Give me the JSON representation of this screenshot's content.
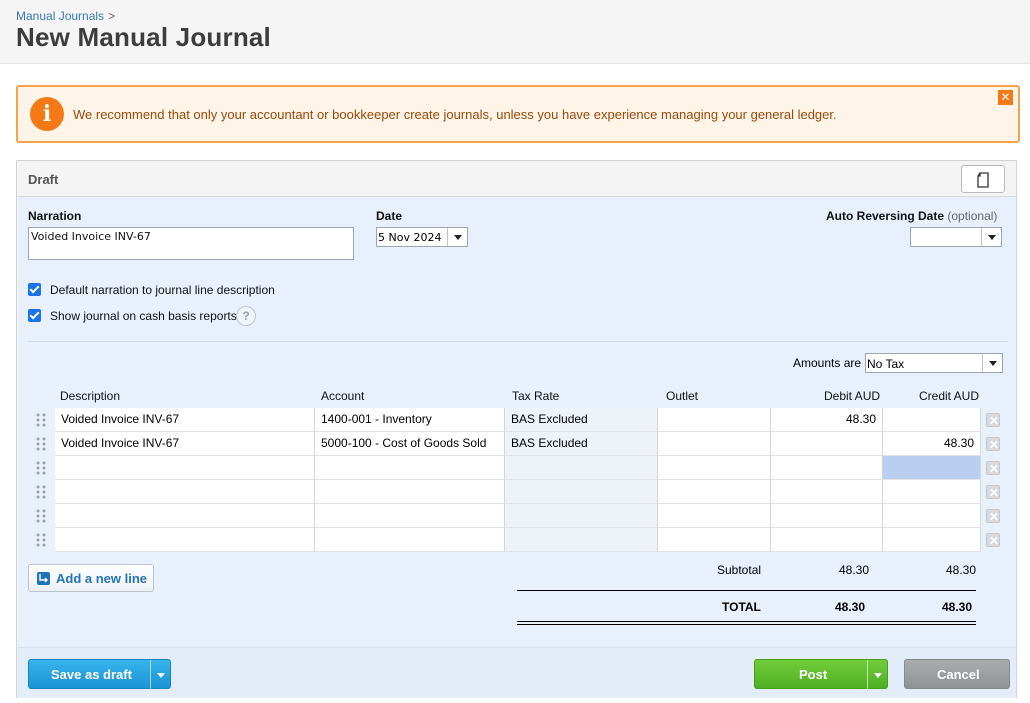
{
  "breadcrumb": {
    "parent": "Manual Journals",
    "separator": ">"
  },
  "page": {
    "title": "New Manual Journal"
  },
  "warning": {
    "message": "We recommend that only your accountant or bookkeeper create journals, unless you have experience managing your general ledger.",
    "icon": "info-icon",
    "close": "✕"
  },
  "panel": {
    "status": "Draft"
  },
  "form": {
    "narration_label": "Narration",
    "narration_value": "Voided Invoice INV-67",
    "date_label": "Date",
    "date_value": "5 Nov 2024",
    "auto_reversing_label": "Auto Reversing Date",
    "auto_reversing_optional": "(optional)",
    "auto_reversing_value": "",
    "default_narration_label": "Default narration to journal line description",
    "default_narration_checked": true,
    "cash_basis_label": "Show journal on cash basis reports",
    "cash_basis_checked": true,
    "help": "?",
    "amounts_are_label": "Amounts are",
    "amounts_are_value": "No Tax"
  },
  "table": {
    "headers": [
      "Description",
      "Account",
      "Tax Rate",
      "Outlet",
      "Debit AUD",
      "Credit AUD"
    ],
    "rows": [
      [
        "Voided Invoice INV-67",
        "1400-001 - Inventory",
        "BAS Excluded",
        "",
        "48.30",
        ""
      ],
      [
        "Voided Invoice INV-67",
        "5000-100 - Cost of Goods Sold",
        "BAS Excluded",
        "",
        "",
        "48.30"
      ],
      [
        "",
        "",
        "",
        "",
        "",
        ""
      ],
      [
        "",
        "",
        "",
        "",
        "",
        ""
      ],
      [
        "",
        "",
        "",
        "",
        "",
        ""
      ],
      [
        "",
        "",
        "",
        "",
        "",
        ""
      ]
    ]
  },
  "add_line_label": "Add a new line",
  "totals": {
    "subtotal_label": "Subtotal",
    "subtotal_debit": "48.30",
    "subtotal_credit": "48.30",
    "total_label": "TOTAL",
    "total_debit": "48.30",
    "total_credit": "48.30"
  },
  "buttons": {
    "save_draft": "Save as draft",
    "post": "Post",
    "cancel": "Cancel"
  },
  "colors": {
    "warning_border": "#f7a34a",
    "warning_icon": "#f57a17",
    "save_button": "#1d93d3",
    "post_button": "#4fae22",
    "cancel_button": "#8f9396",
    "active_cell": "#b9cff0"
  }
}
